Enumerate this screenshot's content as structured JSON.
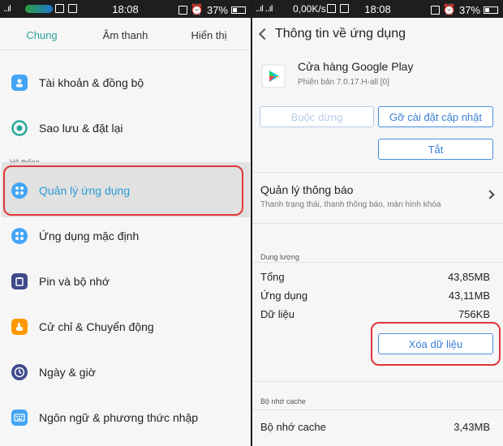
{
  "left": {
    "status": {
      "clock": "18:08",
      "battery": "37%",
      "signal": "..ıl"
    },
    "tabs": [
      "Chung",
      "Âm thanh",
      "Hiển thị"
    ],
    "items": [
      {
        "label": "Tài khoản & đồng bộ",
        "icon": "person-icon",
        "color": "#42a5f5"
      },
      {
        "label": "Sao lưu & đặt lại",
        "icon": "backup-icon",
        "color": "#26a69a"
      },
      {
        "label": "Quản lý ứng dụng",
        "icon": "apps-icon",
        "color": "#42a5f5"
      },
      {
        "label": "Ứng dụng mặc định",
        "icon": "default-apps-icon",
        "color": "#42a5f5"
      },
      {
        "label": "Pin và bộ nhớ",
        "icon": "battery-storage-icon",
        "color": "#3f4a8a"
      },
      {
        "label": "Cử chỉ & Chuyển động",
        "icon": "gesture-icon",
        "color": "#ff9800"
      },
      {
        "label": "Ngày & giờ",
        "icon": "clock-icon",
        "color": "#3f4a8a"
      },
      {
        "label": "Ngôn ngữ & phương thức nhập",
        "icon": "keyboard-icon",
        "color": "#42a5f5"
      }
    ],
    "section_system": "Hệ thống",
    "accent": "#2aa39a"
  },
  "right": {
    "status": {
      "clock": "18:08",
      "battery": "37%",
      "speed": "0,00K/s"
    },
    "title": "Thông tin về ứng dụng",
    "app": {
      "name": "Cửa hàng Google Play",
      "version": "Phiên bản 7.0.17.H-all [0]"
    },
    "buttons": {
      "force_stop": "Buộc dừng",
      "uninstall_updates": "Gỡ cài đặt cập nhật",
      "disable": "Tắt",
      "clear_data": "Xóa dữ liệu"
    },
    "notifications": {
      "title": "Quản lý thông báo",
      "subtitle": "Thanh trạng thái, thanh thông báo, màn hình khóa"
    },
    "storage": {
      "section": "Dung lượng",
      "rows": [
        {
          "label": "Tổng",
          "value": "43,85MB"
        },
        {
          "label": "Ứng dụng",
          "value": "43,11MB"
        },
        {
          "label": "Dữ liệu",
          "value": "756KB"
        }
      ]
    },
    "cache": {
      "section": "Bộ nhớ cache",
      "label": "Bộ nhớ cache",
      "value": "3,43MB"
    }
  }
}
